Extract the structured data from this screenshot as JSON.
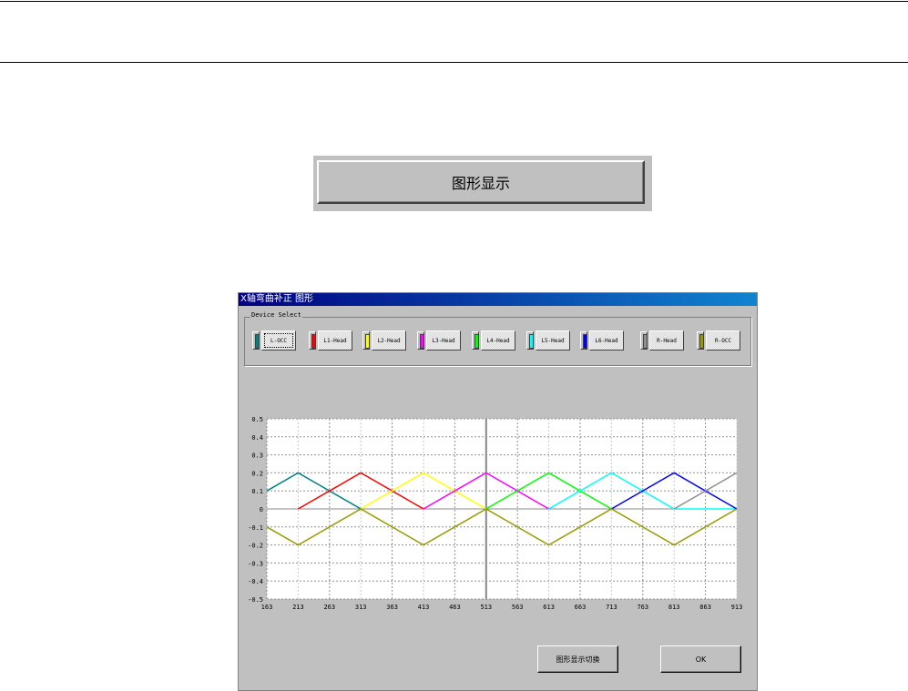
{
  "main_button": {
    "label": "图形显示"
  },
  "dialog": {
    "title": "X轴弯曲补正 图形",
    "group_label": "Device Select",
    "devices": [
      {
        "label": "L-OCC",
        "color": "#008080"
      },
      {
        "label": "L1-Head",
        "color": "#ff0000"
      },
      {
        "label": "L2-Head",
        "color": "#ffff00"
      },
      {
        "label": "L3-Head",
        "color": "#ff00ff"
      },
      {
        "label": "L4-Head",
        "color": "#00ff00"
      },
      {
        "label": "L5-Head",
        "color": "#00ffff"
      },
      {
        "label": "L6-Head",
        "color": "#0000ff"
      },
      {
        "label": "R-Head",
        "color": "#909090"
      },
      {
        "label": "R-OCC",
        "color": "#999900"
      }
    ],
    "toggle_button": "图形显示切换",
    "ok_button": "OK"
  },
  "chart_data": {
    "type": "line",
    "xlim": [
      163,
      913
    ],
    "ylim": [
      -0.5,
      0.5
    ],
    "xticks": [
      "163",
      "213",
      "263",
      "313",
      "363",
      "413",
      "463",
      "513",
      "563",
      "613",
      "663",
      "713",
      "763",
      "813",
      "863",
      "913"
    ],
    "yticks": [
      "0.5",
      "0.4",
      "0.3",
      "0.2",
      "0.1",
      "0",
      "-0.1",
      "-0.2",
      "-0.3",
      "-0.4",
      "-0.5"
    ],
    "grid": true,
    "cursor_x": 513,
    "series": [
      {
        "name": "L-OCC",
        "color": "#008080",
        "points": [
          [
            163,
            0.1
          ],
          [
            213,
            0.2
          ],
          [
            313,
            0
          ]
        ]
      },
      {
        "name": "L1-Head",
        "color": "#ff0000",
        "points": [
          [
            213,
            0
          ],
          [
            313,
            0.2
          ],
          [
            413,
            0
          ]
        ]
      },
      {
        "name": "L2-Head",
        "color": "#ffff00",
        "points": [
          [
            313,
            0
          ],
          [
            413,
            0.2
          ],
          [
            513,
            0
          ]
        ]
      },
      {
        "name": "L3-Head",
        "color": "#ff00ff",
        "points": [
          [
            413,
            0
          ],
          [
            513,
            0.2
          ],
          [
            613,
            0
          ]
        ]
      },
      {
        "name": "L4-Head",
        "color": "#00ff00",
        "points": [
          [
            513,
            0
          ],
          [
            613,
            0.2
          ],
          [
            713,
            0
          ]
        ]
      },
      {
        "name": "L5-Head",
        "color": "#00ffff",
        "points": [
          [
            613,
            0
          ],
          [
            713,
            0.2
          ],
          [
            813,
            0
          ],
          [
            913,
            0
          ]
        ]
      },
      {
        "name": "L6-Head",
        "color": "#0000ff",
        "points": [
          [
            713,
            0
          ],
          [
            813,
            0.2
          ],
          [
            913,
            0
          ]
        ]
      },
      {
        "name": "R-Head",
        "color": "#909090",
        "points": [
          [
            813,
            0
          ],
          [
            913,
            0.2
          ]
        ]
      },
      {
        "name": "R-OCC",
        "color": "#999900",
        "points": [
          [
            163,
            -0.1
          ],
          [
            213,
            -0.2
          ],
          [
            313,
            0
          ],
          [
            413,
            -0.2
          ],
          [
            513,
            0
          ],
          [
            613,
            -0.2
          ],
          [
            713,
            0
          ],
          [
            813,
            -0.2
          ],
          [
            913,
            0
          ]
        ]
      }
    ]
  }
}
